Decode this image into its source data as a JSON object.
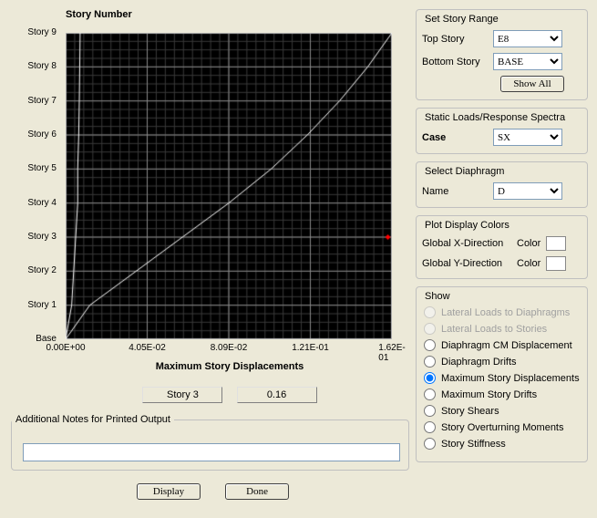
{
  "chart_data": {
    "type": "line",
    "title": "Story Number",
    "xlabel": "Maximum Story Displacements",
    "ylabel": "",
    "xlim": [
      0,
      0.162
    ],
    "x_ticks": [
      "0.00E+00",
      "4.05E-02",
      "8.09E-02",
      "1.21E-01",
      "1.62E-01"
    ],
    "y_categories": [
      "Base",
      "Story 1",
      "Story 2",
      "Story 3",
      "Story 4",
      "Story 5",
      "Story 6",
      "Story 7",
      "Story 8",
      "Story 9"
    ],
    "series": [
      {
        "name": "Global X",
        "color": "#ffffff",
        "x": [
          0.0,
          0.003,
          0.004,
          0.005,
          0.006,
          0.006,
          0.0065,
          0.0068,
          0.007,
          0.0072
        ]
      },
      {
        "name": "Global Y",
        "color": "#ffffff",
        "x": [
          0.0,
          0.012,
          0.035,
          0.058,
          0.081,
          0.102,
          0.12,
          0.136,
          0.15,
          0.162
        ]
      }
    ],
    "marker": {
      "story": "Story 3",
      "x": 0.16,
      "color": "#ff0000"
    }
  },
  "readout": {
    "story": "Story 3",
    "value": "0.16"
  },
  "notes": {
    "legend": "Additional Notes for Printed Output",
    "value": ""
  },
  "buttons": {
    "display": "Display",
    "done": "Done"
  },
  "story_range": {
    "legend": "Set Story Range",
    "top_label": "Top Story",
    "top_value": "E8",
    "bottom_label": "Bottom Story",
    "bottom_value": "BASE",
    "show_all": "Show All"
  },
  "load_case": {
    "legend": "Static Loads/Response Spectra",
    "label": "Case",
    "value": "SX"
  },
  "diaphragm": {
    "legend": "Select  Diaphragm",
    "label": "Name",
    "value": "D"
  },
  "plot_colors": {
    "legend": "Plot Display Colors",
    "x_label": "Global X-Direction",
    "x_btn": "Color",
    "y_label": "Global Y-Direction",
    "y_btn": "Color"
  },
  "show": {
    "legend": "Show",
    "options": [
      {
        "label": "Lateral Loads to Diaphragms",
        "enabled": false,
        "checked": false
      },
      {
        "label": "Lateral Loads to Stories",
        "enabled": false,
        "checked": false
      },
      {
        "label": "Diaphragm CM Displacement",
        "enabled": true,
        "checked": false
      },
      {
        "label": "Diaphragm Drifts",
        "enabled": true,
        "checked": false
      },
      {
        "label": "Maximum Story Displacements",
        "enabled": true,
        "checked": true
      },
      {
        "label": "Maximum Story Drifts",
        "enabled": true,
        "checked": false
      },
      {
        "label": "Story Shears",
        "enabled": true,
        "checked": false
      },
      {
        "label": "Story Overturning Moments",
        "enabled": true,
        "checked": false
      },
      {
        "label": "Story Stiffness",
        "enabled": true,
        "checked": false
      }
    ]
  }
}
